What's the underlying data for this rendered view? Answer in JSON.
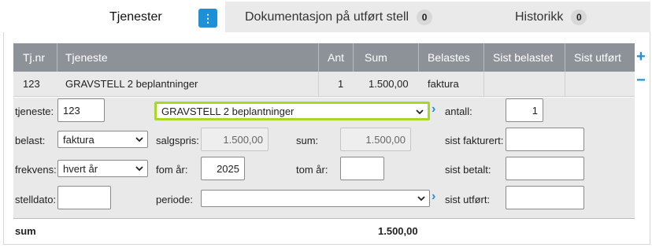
{
  "tabs": [
    {
      "label": "Tjenester"
    },
    {
      "label": "Dokumentasjon på utført stell",
      "badge": "0"
    },
    {
      "label": "Historikk",
      "badge": "0"
    }
  ],
  "menu_icon": "kebab-menu-icon",
  "table": {
    "headers": [
      "Tj.nr",
      "Tjeneste",
      "Ant",
      "Sum",
      "Belastes",
      "Sist belastet",
      "Sist utført"
    ],
    "row": {
      "tjnr": "123",
      "tjeneste": "GRAVSTELL 2 beplantninger",
      "ant": "1",
      "sum": "1.500,00",
      "belastes": "faktura",
      "sist_belastet": "",
      "sist_utfort": ""
    }
  },
  "editor": {
    "tjeneste_label": "tjeneste:",
    "tjeneste_value": "123",
    "tjeneste_select": "GRAVSTELL 2 beplantninger",
    "antall_label": "antall:",
    "antall_value": "1",
    "belast_label": "belast:",
    "belast_value": "faktura",
    "salgspris_label": "salgspris:",
    "salgspris_value": "1.500,00",
    "sum_label": "sum:",
    "sum_value": "1.500,00",
    "sist_fakturert_label": "sist fakturert:",
    "frekvens_label": "frekvens:",
    "frekvens_value": "hvert år",
    "fom_label": "fom år:",
    "fom_value": "2025",
    "tom_label": "tom år:",
    "tom_value": "",
    "sist_betalt_label": "sist betalt:",
    "stelldato_label": "stelldato:",
    "stelldato_value": "",
    "periode_label": "periode:",
    "periode_value": "",
    "sist_utfort_label": "sist utført:"
  },
  "footer": {
    "label": "sum",
    "value": "1.500,00"
  },
  "colors": {
    "accent": "#1f8fd6",
    "header": "#8d9299",
    "highlight": "#a7d72b"
  }
}
